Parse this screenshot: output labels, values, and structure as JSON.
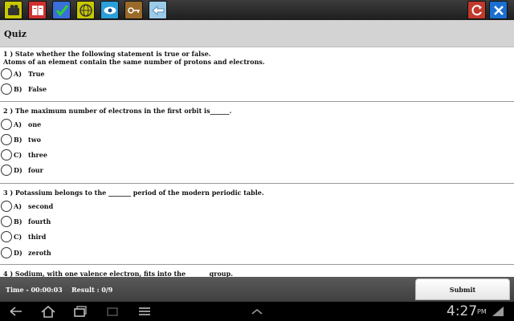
{
  "toolbar": {
    "icons": [
      "camera-icon",
      "book-icon",
      "checklist-icon",
      "globe-icon",
      "eye-icon",
      "key-icon",
      "back-arrow-icon",
      "refresh-icon",
      "close-icon"
    ]
  },
  "header": {
    "title": "Quiz"
  },
  "questions": [
    {
      "text": "1 ) State whether the following statement is true or false.",
      "text2": "Atoms of an element contain the same number of protons and electrons.",
      "options": [
        {
          "letter": "A)",
          "text": "True"
        },
        {
          "letter": "B)",
          "text": "False"
        }
      ]
    },
    {
      "text": "2 ) The maximum number of electrons in the first orbit is______.",
      "options": [
        {
          "letter": "A)",
          "text": "one"
        },
        {
          "letter": "B)",
          "text": "two"
        },
        {
          "letter": "C)",
          "text": "three"
        },
        {
          "letter": "D)",
          "text": "four"
        }
      ]
    },
    {
      "text": "3 ) Potassium belongs to the _______ period of the modern periodic table.",
      "options": [
        {
          "letter": "A)",
          "text": "second"
        },
        {
          "letter": "B)",
          "text": "fourth"
        },
        {
          "letter": "C)",
          "text": "third"
        },
        {
          "letter": "D)",
          "text": "zeroth"
        }
      ]
    },
    {
      "text": "4 ) Sodium, with one valence electron, fits into the ______ group."
    }
  ],
  "status": {
    "time": "Time - 00:00:03",
    "result": "Result : 0/9",
    "submit_label": "Submit"
  },
  "system": {
    "clock": "4:27",
    "ampm": "PM"
  },
  "colors": {
    "toolbar": "#2b2b2b",
    "titlebar": "#d3d3d3",
    "statusbar": "#4d4d4d",
    "close": "#1a6fd0",
    "refresh": "#c0392b"
  }
}
